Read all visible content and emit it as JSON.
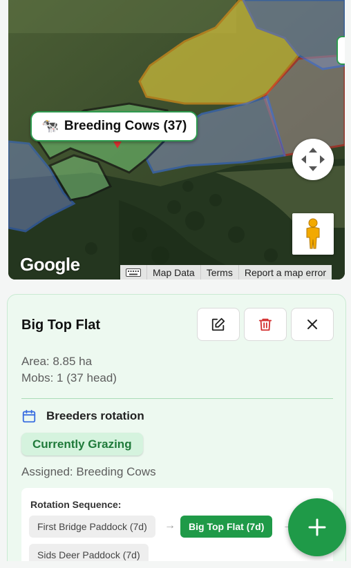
{
  "map": {
    "mob_label": {
      "icon": "cow-icon",
      "emoji": "🐄",
      "text": "Breeding Cows (37)"
    },
    "google_logo": "Google",
    "attribution": {
      "keyboard_icon": "keyboard-icon",
      "map_data": "Map Data",
      "terms": "Terms",
      "report": "Report a map error"
    }
  },
  "panel": {
    "title": "Big Top Flat",
    "area": "Area: 8.85 ha",
    "mobs": "Mobs: 1 (37 head)",
    "rotation_name": "Breeders rotation",
    "status_badge": "Currently Grazing",
    "assigned": "Assigned: Breeding Cows",
    "sequence": {
      "title": "Rotation Sequence:",
      "items": [
        {
          "label": "First Bridge Paddock (7d)",
          "active": false
        },
        {
          "label": "Big Top Flat (7d)",
          "active": true
        },
        {
          "label": "Sids Deer Paddock (7d)",
          "active": false
        }
      ],
      "arrow": "→"
    }
  },
  "colors": {
    "accent_green": "#1f9a48",
    "delete_red": "#d32f2f",
    "panel_bg": "#edf9f0"
  }
}
